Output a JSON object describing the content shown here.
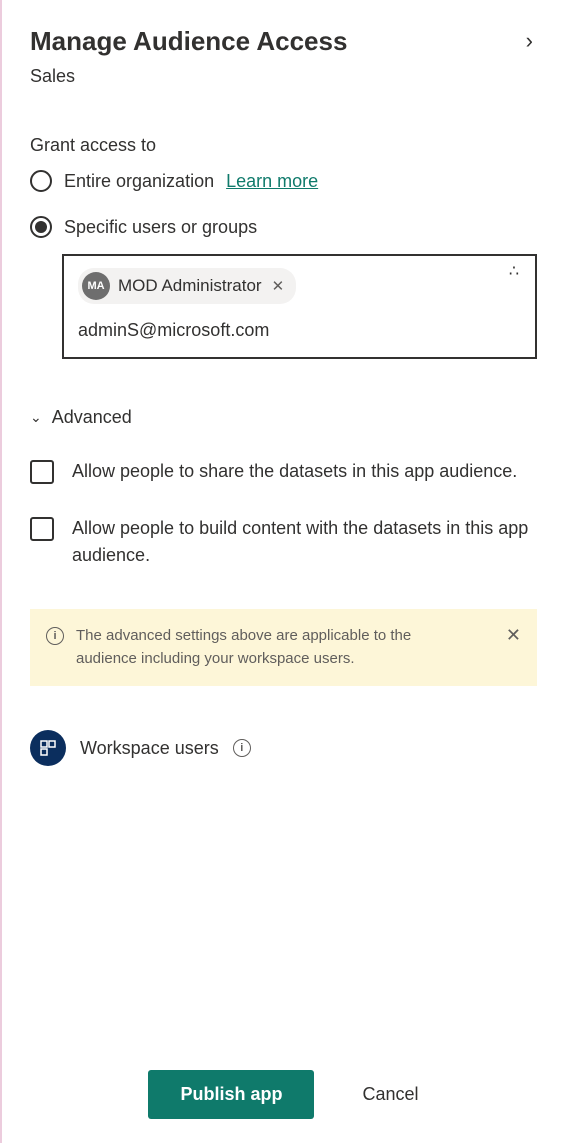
{
  "header": {
    "title": "Manage Audience Access",
    "subtitle": "Sales"
  },
  "grantAccess": {
    "label": "Grant access to",
    "options": {
      "entireOrg": "Entire organization",
      "learnMore": "Learn more",
      "specific": "Specific users or groups"
    },
    "picker": {
      "chip": {
        "initials": "MA",
        "name": "MOD Administrator"
      },
      "inputValue": "adminS@microsoft.com"
    }
  },
  "advanced": {
    "label": "Advanced",
    "options": {
      "allowShare": "Allow people to share the datasets in this app audience.",
      "allowBuild": "Allow people to build content with the datasets in this app audience."
    },
    "banner": "The advanced settings above are applicable to the audience including your workspace users."
  },
  "workspace": {
    "label": "Workspace users"
  },
  "footer": {
    "publish": "Publish app",
    "cancel": "Cancel"
  }
}
